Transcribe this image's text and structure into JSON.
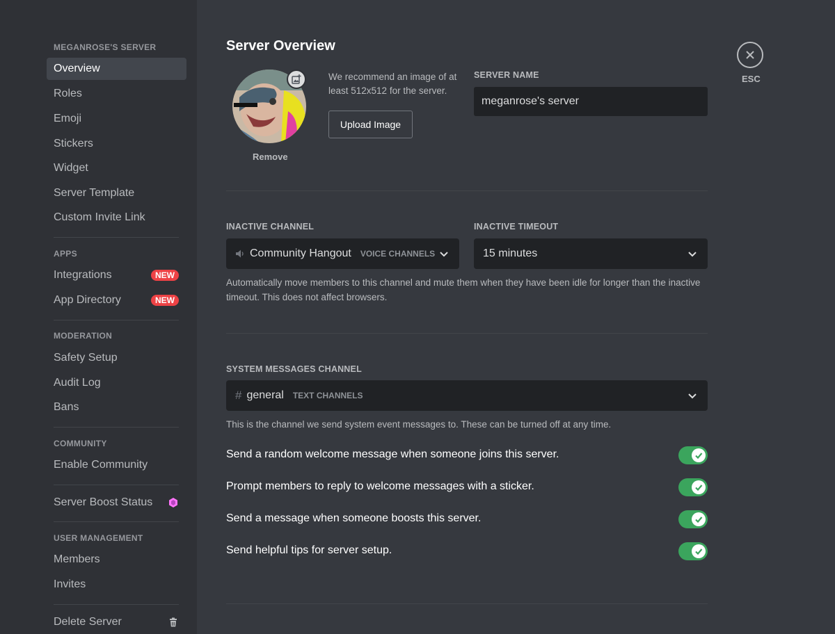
{
  "sidebar": {
    "server_header": "MEGANROSE'S SERVER",
    "server_items": [
      {
        "label": "Overview"
      },
      {
        "label": "Roles"
      },
      {
        "label": "Emoji"
      },
      {
        "label": "Stickers"
      },
      {
        "label": "Widget"
      },
      {
        "label": "Server Template"
      },
      {
        "label": "Custom Invite Link"
      }
    ],
    "apps_header": "APPS",
    "apps_items": [
      {
        "label": "Integrations",
        "badge": "NEW"
      },
      {
        "label": "App Directory",
        "badge": "NEW"
      }
    ],
    "moderation_header": "MODERATION",
    "moderation_items": [
      {
        "label": "Safety Setup"
      },
      {
        "label": "Audit Log"
      },
      {
        "label": "Bans"
      }
    ],
    "community_header": "COMMUNITY",
    "community_items": [
      {
        "label": "Enable Community"
      }
    ],
    "boost_item": {
      "label": "Server Boost Status",
      "icon": "boost-gem-icon"
    },
    "user_mgmt_header": "USER MANAGEMENT",
    "user_mgmt_items": [
      {
        "label": "Members"
      },
      {
        "label": "Invites"
      }
    ],
    "delete_item": {
      "label": "Delete Server",
      "icon": "trash-icon"
    }
  },
  "main": {
    "title": "Server Overview",
    "avatar": {
      "remove_label": "Remove",
      "edit_icon": "add-image-icon"
    },
    "recommend_text": "We recommend an image of at least 512x512 for the server.",
    "upload_button": "Upload Image",
    "server_name": {
      "label": "SERVER NAME",
      "value": "meganrose's server"
    },
    "inactive_channel": {
      "label": "INACTIVE CHANNEL",
      "value": "Community Hangout",
      "hint": "VOICE CHANNELS",
      "icon": "speaker-icon"
    },
    "inactive_timeout": {
      "label": "INACTIVE TIMEOUT",
      "value": "15 minutes"
    },
    "inactive_help": "Automatically move members to this channel and mute them when they have been idle for longer than the inactive timeout. This does not affect browsers.",
    "system_channel": {
      "label": "SYSTEM MESSAGES CHANNEL",
      "value": "general",
      "hint": "TEXT CHANNELS",
      "icon": "hash-icon"
    },
    "system_help": "This is the channel we send system event messages to. These can be turned off at any time.",
    "toggles": [
      {
        "label": "Send a random welcome message when someone joins this server.",
        "on": true
      },
      {
        "label": "Prompt members to reply to welcome messages with a sticker.",
        "on": true
      },
      {
        "label": "Send a message when someone boosts this server.",
        "on": true
      },
      {
        "label": "Send helpful tips for server setup.",
        "on": true
      }
    ]
  },
  "close": {
    "label": "ESC",
    "icon": "close-icon"
  },
  "colors": {
    "accent_green": "#3ba55d",
    "badge_red": "#ed4245",
    "boost_pink": "#ff73fa"
  }
}
